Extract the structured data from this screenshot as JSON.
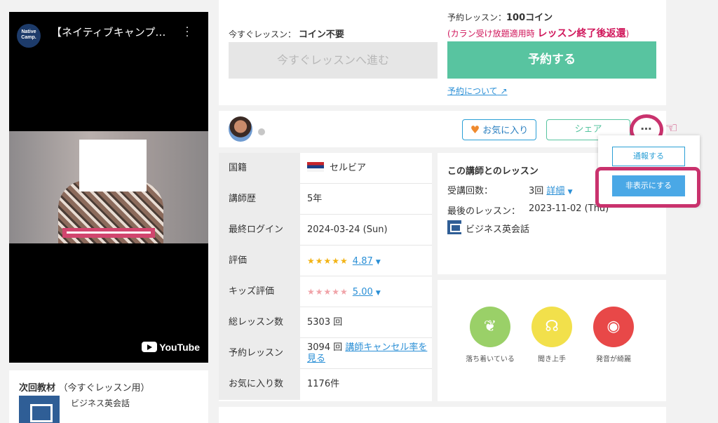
{
  "video": {
    "channel_logo": "Native Camp.",
    "title": "【ネイティブキャンプ…",
    "brand": "YouTube"
  },
  "next_material": {
    "title": "次回教材",
    "sub": "（今すぐレッスン用）",
    "course": "ビジネス英会話"
  },
  "booking": {
    "now_label": "今すぐレッスン：",
    "now_cost": "コイン不要",
    "now_button": "今すぐレッスンへ進む",
    "res_label": "予約レッスン：",
    "res_cost": "100コイン",
    "res_note_prefix": "(カラン受け放題適用時",
    "res_note_bold": "レッスン終了後返還",
    "res_note_suffix": ")",
    "res_button": "予約する",
    "res_link": "予約について"
  },
  "profile": {
    "fav_button": "お気に入り",
    "share_button": "シェア",
    "more_button": "…"
  },
  "dropdown": {
    "report": "通報する",
    "hide": "非表示にする"
  },
  "info": {
    "nationality_label": "国籍",
    "nationality": "セルビア",
    "experience_label": "講師歴",
    "experience": "5年",
    "last_login_label": "最終ログイン",
    "last_login": "2024-03-24 (Sun)",
    "rating_label": "評価",
    "rating": "4.87",
    "kids_rating_label": "キッズ評価",
    "kids_rating": "5.00",
    "total_lessons_label": "総レッスン数",
    "total_lessons": "5303 回",
    "reserved_label": "予約レッスン",
    "reserved": "3094 回",
    "reserved_link": "講師キャンセル率を見る",
    "favorites_label": "お気に入り数",
    "favorites": "1176件"
  },
  "lesson": {
    "title": "この講師とのレッスン",
    "count_label": "受講回数：",
    "count": "3回",
    "detail_link": "詳細",
    "last_label": "最後のレッスン：",
    "last_value": "2023-11-02 (Thu)",
    "course": "ビジネス英会話"
  },
  "badges": [
    {
      "label": "落ち着いている",
      "color": "#9ad068",
      "icon": "sprout-icon"
    },
    {
      "label": "聞き上手",
      "color": "#f2e04b",
      "icon": "ear-icon"
    },
    {
      "label": "発音が綺麗",
      "color": "#e84848",
      "icon": "lips-icon"
    }
  ]
}
